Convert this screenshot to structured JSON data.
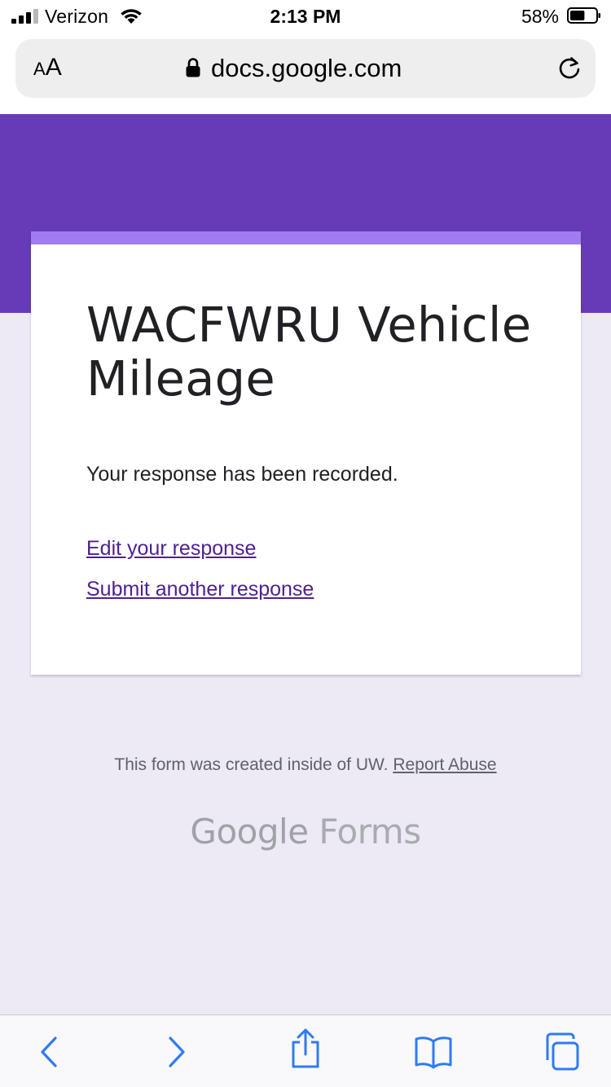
{
  "status_bar": {
    "carrier": "Verizon",
    "time": "2:13 PM",
    "battery_percent": "58%",
    "battery_level": 0.58
  },
  "browser": {
    "text_size_label_small": "A",
    "text_size_label_large": "A",
    "url": "docs.google.com"
  },
  "form": {
    "title": "WACFWRU Vehicle Mileage",
    "confirmation": "Your response has been recorded.",
    "edit_link": "Edit your response",
    "submit_another_link": "Submit another response"
  },
  "footer": {
    "notice": "This form was created inside of UW.",
    "report_link": "Report Abuse",
    "logo_google": "Google",
    "logo_forms": "Forms"
  },
  "colors": {
    "header_purple": "#673ab7",
    "card_accent": "#a07cf0",
    "link": "#4f2191",
    "page_background": "#ede9f5",
    "ios_blue": "#2f7bf6"
  },
  "toolbar": {
    "icons": [
      "back-icon",
      "forward-icon",
      "share-icon",
      "bookmarks-icon",
      "tabs-icon"
    ]
  }
}
